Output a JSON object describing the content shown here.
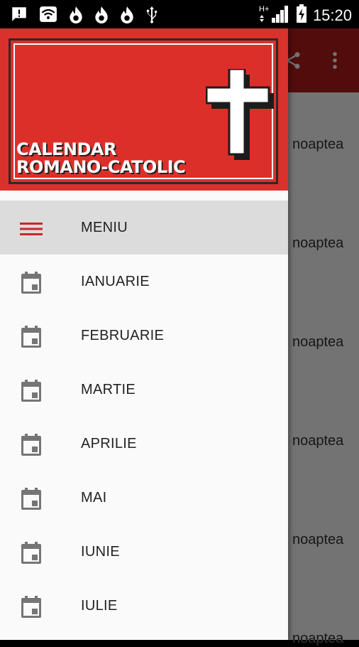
{
  "status_bar": {
    "time": "15:20",
    "network": "H+"
  },
  "background_app": {
    "rows": [
      "noaptea",
      "noaptea",
      "noaptea",
      "noaptea",
      "noaptea",
      "noaptea"
    ]
  },
  "drawer": {
    "header": {
      "title_line1": "CALENDAR",
      "title_line2": "ROMANO-CATOLIC"
    },
    "items": [
      {
        "label": "MENIU",
        "icon": "hamburger-icon",
        "active": true
      },
      {
        "label": "IANUARIE",
        "icon": "calendar-icon"
      },
      {
        "label": "FEBRUARIE",
        "icon": "calendar-icon"
      },
      {
        "label": "MARTIE",
        "icon": "calendar-icon"
      },
      {
        "label": "APRILIE",
        "icon": "calendar-icon"
      },
      {
        "label": "MAI",
        "icon": "calendar-icon"
      },
      {
        "label": "IUNIE",
        "icon": "calendar-icon"
      },
      {
        "label": "IULIE",
        "icon": "calendar-icon"
      }
    ]
  },
  "colors": {
    "brand_red": "#d9312b",
    "toolbar_red": "#b71c1c",
    "menu_icon_red": "#c62828",
    "icon_gray": "#757575"
  }
}
